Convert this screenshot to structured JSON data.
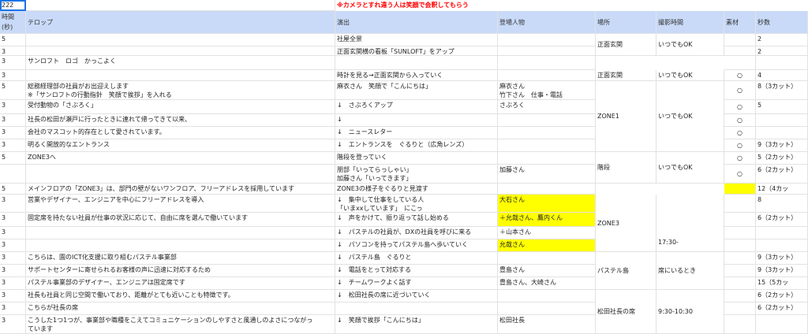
{
  "sheet": {
    "a1_value": "222",
    "notice": "※カメラとすれ違う人は笑顔で会釈してもらう",
    "colors": {
      "header_bg": "#c9daf8",
      "highlight": "#ffff00",
      "notice": "#ff0000",
      "selection": "#1a73e8"
    }
  },
  "headers": {
    "time": "時間\n(秒)",
    "telop": "テロップ",
    "direction": "演出",
    "cast": "登場人物",
    "place": "場所",
    "shoot_time": "撮影時間",
    "material": "素材",
    "seconds": "秒数"
  },
  "rows": [
    {
      "time": "5",
      "telop": "",
      "direction": "社屋全景",
      "cast": "",
      "material": "",
      "seconds": "2"
    },
    {
      "time": "3",
      "telop": "",
      "direction": "正面玄関横の看板「SUNLOFT」をアップ",
      "cast": "",
      "material": "",
      "seconds": "2"
    },
    {
      "time": "3",
      "telop": "サンロフト　ロゴ　かっこよく",
      "direction": "",
      "cast": "",
      "material": "",
      "seconds": ""
    },
    {
      "time": "3",
      "telop": "",
      "direction": "時計を見る→正面玄関から入っていく",
      "cast": "",
      "material": "○",
      "seconds": "4"
    },
    {
      "time": "5",
      "telop": "総務経理部の社員がお出迎えします\n※「サンロフトの行動指針　笑顔で挨拶」を入れる",
      "direction": "麻衣さん　笑顔で「こんにちは」",
      "cast": "麻衣さん\n竹下さん　仕事・電話",
      "material": "○",
      "seconds": "8（3カット）"
    },
    {
      "time": "3",
      "telop": "受付動物の「さぶろく」",
      "direction": "↓　さぶろくアップ",
      "cast": "さぶろく",
      "material": "○",
      "seconds": "5"
    },
    {
      "time": "3",
      "telop": "社長の松田が瀬戸に行ったときに連れて帰ってきて以来、",
      "direction": "↓",
      "cast": "",
      "material": "○",
      "seconds": ""
    },
    {
      "time": "3",
      "telop": "会社のマスコット的存在として愛されています。",
      "direction": "↓　ニュースレター",
      "cast": "",
      "material": "○",
      "seconds": ""
    },
    {
      "time": "3",
      "telop": "明るく開放的なエントランス",
      "direction": "↓　エントランスを　ぐるりと（広角レンズ）",
      "cast": "",
      "material": "○",
      "seconds": "9（3カット）"
    },
    {
      "time": "5",
      "telop": "ZONE3へ",
      "direction": "階段を登っていく",
      "cast": "",
      "material": "○",
      "seconds": "5（2カット）"
    },
    {
      "time": "",
      "telop": "",
      "direction": "朋部「いってらっしゃい」\n加藤さん「いってきます」",
      "cast": "加藤さん",
      "material": "○",
      "seconds": "6（2カット）"
    },
    {
      "time": "5",
      "telop": "メインフロアの「ZONE3」は、部門の壁がないワンフロア、フリーアドレスを採用しています",
      "direction": "ZONE3の様子をぐるりと見渡す",
      "cast": "",
      "material": "",
      "seconds": "12（4カッ"
    },
    {
      "time": "3",
      "telop": "営業やデザイナー、エンジニアを中心にフリーアドレスを導入",
      "direction": "↓　集中して仕事をしている人\n「いまxxしています」　にこっ",
      "cast": "大石さん",
      "material": "",
      "seconds": "8"
    },
    {
      "time": "3",
      "telop": "固定席を持たない社員が仕事の状況に応じて、自由に席を選んで働いています",
      "direction": "↓　声をかけて、振り返って話し始める",
      "cast": "＋允哉さん、鷹内くん",
      "material": "",
      "seconds": "6（2カット）"
    },
    {
      "time": "3",
      "telop": "",
      "direction": "↓　パステルの社員が、DXの社員を呼びに来る",
      "cast": "＋山本さん",
      "material": "",
      "seconds": ""
    },
    {
      "time": "3",
      "telop": "",
      "direction": "↓　パソコンを持ってパステル島へ歩いていく",
      "cast": "允哉さん",
      "material": "",
      "seconds": ""
    },
    {
      "time": "3",
      "telop": "こちらは、園のICT化支援に取り組むパステル事業部",
      "direction": "↓　パステル島　ぐるりと",
      "cast": "",
      "material": "",
      "seconds": "9（3カット）"
    },
    {
      "time": "3",
      "telop": "サポートセンターに寄せられるお客様の声に迅速に対応するため",
      "direction": "↓　電話をとって対応する",
      "cast": "豊島さん",
      "material": "",
      "seconds": "9（3カット）"
    },
    {
      "time": "3",
      "telop": "パステル事業部のデザイナー、エンジニアは固定席です",
      "direction": "↓　チームワークよく話す",
      "cast": "豊島さん、大崎さん",
      "material": "",
      "seconds": "15（5カッ"
    },
    {
      "time": "3",
      "telop": "社長も社員と同じ空間で働いており、距離がとても近いことも特徴です。",
      "direction": "↓　松田社長の席に近づいていく",
      "cast": "",
      "material": "",
      "seconds": "6（2カット）"
    },
    {
      "time": "3",
      "telop": "こちらが社長の席",
      "direction": "",
      "cast": "",
      "material": "",
      "seconds": "6（2カット）"
    },
    {
      "time": "3",
      "telop": "こうした1つ1つが、事業部や職種をこえてコミュニケーションのしやすさと風通しのよさにつながっ\nています",
      "direction": "↓　笑顔で挨拶「こんにちは」",
      "cast": "松田社長",
      "material": "",
      "seconds": ""
    }
  ],
  "merged": [
    {
      "place": "正面玄関",
      "shoot_time": "いつでもOK"
    },
    {
      "place": "正面玄関",
      "shoot_time": "いつでもOK"
    },
    {
      "place": "ZONE1",
      "shoot_time": "いつでもOK"
    },
    {
      "place": "階段",
      "shoot_time": "いつでもOK"
    },
    {
      "place": "ZONE3",
      "shoot_time": "17:30-"
    },
    {
      "place": "パステル島",
      "shoot_time": "席にいるとき"
    },
    {
      "place": "松田社長の席",
      "shoot_time": "9:30-10:30"
    }
  ]
}
